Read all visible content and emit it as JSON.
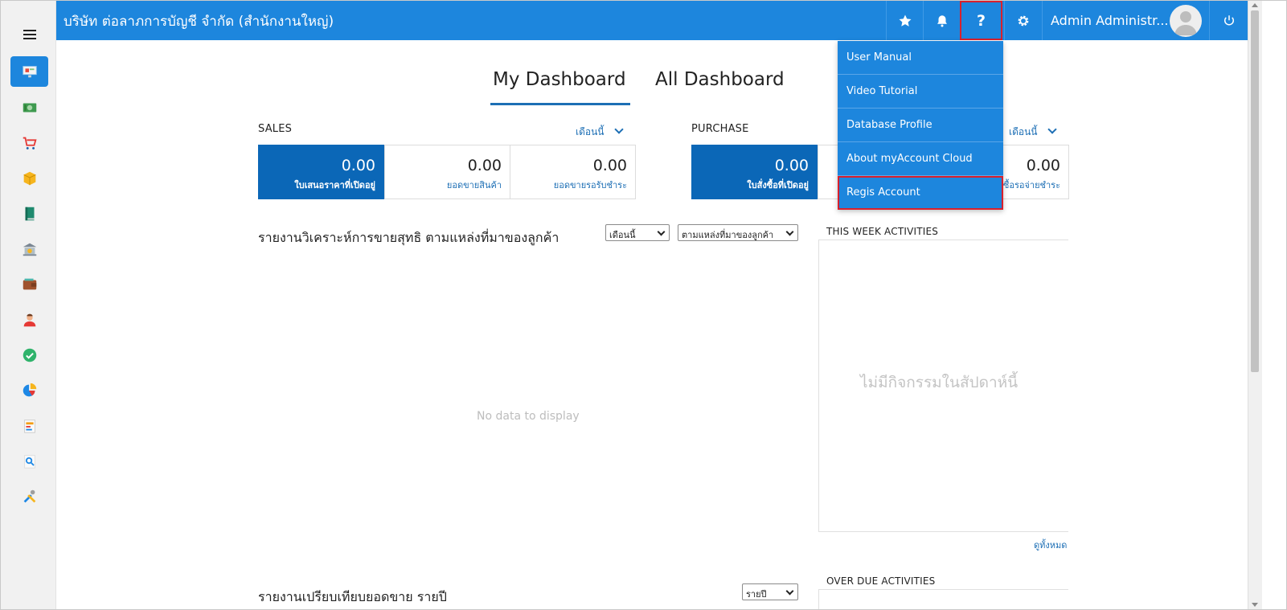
{
  "header": {
    "company_name": "บริษัท ต่อลาภการบัญชี จำกัด (สำนักงานใหญ่)",
    "user_name": "Admin Administr...",
    "icons": [
      "star-icon",
      "bell-icon",
      "help-icon",
      "gear-icon",
      "avatar",
      "power-icon"
    ]
  },
  "sidebar": {
    "items": [
      {
        "name": "dashboard-icon",
        "active": true
      },
      {
        "name": "money-icon"
      },
      {
        "name": "cart-icon"
      },
      {
        "name": "box-icon"
      },
      {
        "name": "book-icon"
      },
      {
        "name": "bank-icon"
      },
      {
        "name": "wallet-icon"
      },
      {
        "name": "person-icon"
      },
      {
        "name": "check-icon"
      },
      {
        "name": "pie-chart-icon"
      },
      {
        "name": "report-icon"
      },
      {
        "name": "search-icon"
      },
      {
        "name": "tools-icon"
      }
    ]
  },
  "tabs": {
    "my_dashboard": "My Dashboard",
    "all_dashboard": "All Dashboard"
  },
  "sales": {
    "title": "SALES",
    "period": "เดือนนี้",
    "cards": [
      {
        "value": "0.00",
        "label": "ใบเสนอราคาที่เปิดอยู่"
      },
      {
        "value": "0.00",
        "label": "ยอดขายสินค้า"
      },
      {
        "value": "0.00",
        "label": "ยอดขายรอรับชำระ"
      }
    ]
  },
  "purchase": {
    "title": "PURCHASE",
    "period": "เดือนนี้",
    "cards": [
      {
        "value": "0.00",
        "label": "ใบสั่งซื้อที่เปิดอยู่"
      },
      {
        "value": "0.00",
        "label": "ซื้อรอจ่ายชำระ"
      }
    ]
  },
  "report": {
    "title": "รายงานวิเคราะห์การขายสุทธิ ตามแหล่งที่มาของลูกค้า",
    "period_select": "เดือนนี้",
    "source_select": "ตามแหล่งที่มาของลูกค้า",
    "empty_text": "No data to display"
  },
  "report2": {
    "title": "รายงานเปรียบเทียบยอดขาย รายปี",
    "select": "รายปี"
  },
  "activities": {
    "week_title": "THIS WEEK ACTIVITIES",
    "week_empty": "ไม่มีกิจกรรมในสัปดาห์นี้",
    "see_all": "ดูทั้งหมด",
    "overdue_title": "OVER DUE ACTIVITIES"
  },
  "help_menu": {
    "items": [
      {
        "label": "User Manual"
      },
      {
        "label": "Video Tutorial"
      },
      {
        "label": "Database Profile"
      },
      {
        "label": "About myAccount Cloud"
      },
      {
        "label": "Regis Account",
        "highlighted": true
      }
    ]
  },
  "colors": {
    "primary": "#1d86dd",
    "card_primary": "#0b67b7",
    "highlight_border": "#d8202d"
  }
}
